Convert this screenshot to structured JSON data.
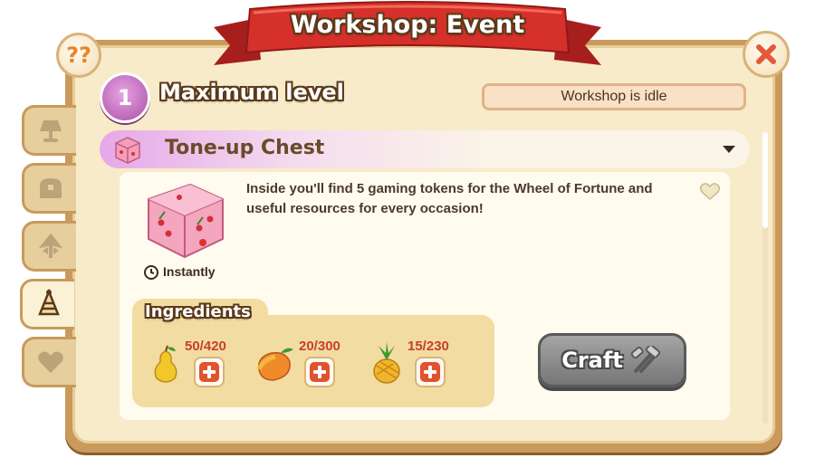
{
  "header": {
    "title": "Workshop: Event"
  },
  "buttons": {
    "help_label": "??"
  },
  "level": {
    "number": "1",
    "title": "Maximum level"
  },
  "workshop": {
    "status": "Workshop is idle"
  },
  "recipe": {
    "name": "Tone-up Chest",
    "description": "Inside you'll find 5 gaming tokens for the Wheel of Fortune and useful resources for every occasion!",
    "craft_time": "Instantly"
  },
  "ingredients": {
    "label": "Ingredients",
    "items": [
      {
        "icon": "pear-icon",
        "count": "50/420"
      },
      {
        "icon": "mango-icon",
        "count": "20/300"
      },
      {
        "icon": "pineapple-icon",
        "count": "15/230"
      }
    ]
  },
  "craft": {
    "label": "Craft"
  },
  "side_tabs": [
    {
      "icon": "lamp-icon",
      "active": false
    },
    {
      "icon": "chest-icon",
      "active": false
    },
    {
      "icon": "plant-icon",
      "active": false
    },
    {
      "icon": "party-hat-icon",
      "active": true
    },
    {
      "icon": "heart-icon",
      "active": false
    }
  ],
  "colors": {
    "accent": "#c8402a",
    "ribbon": "#d6302a",
    "badge": "#a84ea5"
  }
}
